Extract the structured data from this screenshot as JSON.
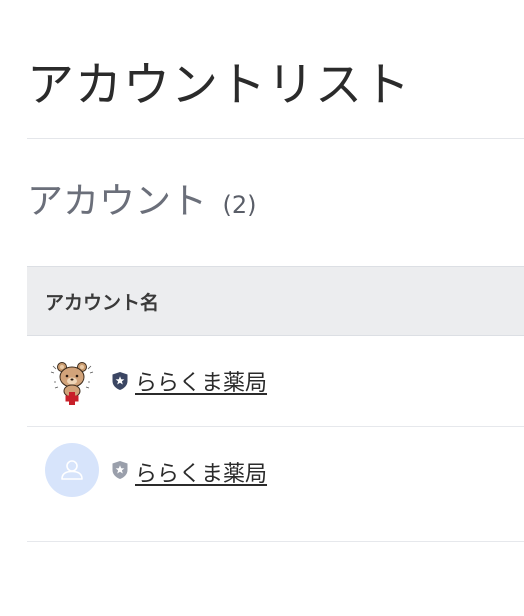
{
  "page": {
    "title": "アカウントリスト"
  },
  "section": {
    "title": "アカウント",
    "count": "(2)"
  },
  "table": {
    "header": "アカウント名",
    "rows": [
      {
        "name": "ららくま薬局",
        "avatar": "bear-icon",
        "badge": "shield-star-icon",
        "badge_color": "#3b4663"
      },
      {
        "name": "ららくま薬局",
        "avatar": "default-user-icon",
        "badge": "shield-star-icon",
        "badge_color": "#9a9fab"
      }
    ]
  },
  "colors": {
    "avatar_default_bg": "#d7e4fb",
    "header_bg": "#ecedef"
  }
}
